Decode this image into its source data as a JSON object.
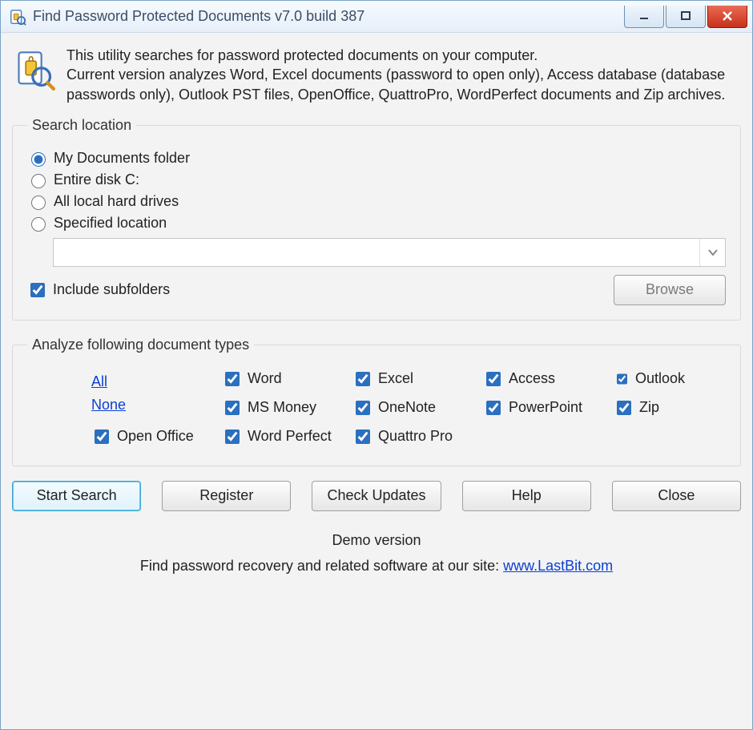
{
  "window": {
    "title": "Find Password Protected Documents v7.0 build 387"
  },
  "header": {
    "description": "This utility searches for password protected documents on your computer.\nCurrent version analyzes Word, Excel documents (password to open only), Access database (database passwords only), Outlook PST files, OpenOffice, QuattroPro, WordPerfect documents and Zip archives."
  },
  "search_location": {
    "legend": "Search location",
    "options": [
      {
        "label": "My Documents folder",
        "selected": true
      },
      {
        "label": "Entire disk C:",
        "selected": false
      },
      {
        "label": "All local hard drives",
        "selected": false
      },
      {
        "label": "Specified location",
        "selected": false
      }
    ],
    "path_value": "",
    "include_subfolders_label": "Include subfolders",
    "include_subfolders_checked": true,
    "browse_label": "Browse"
  },
  "doc_types": {
    "legend": "Analyze following document types",
    "items": [
      {
        "label": "Word",
        "checked": true
      },
      {
        "label": "Excel",
        "checked": true
      },
      {
        "label": "Access",
        "checked": true
      },
      {
        "label": "Outlook",
        "checked": true
      },
      {
        "label": "MS Money",
        "checked": true
      },
      {
        "label": "OneNote",
        "checked": true
      },
      {
        "label": "PowerPoint",
        "checked": true
      },
      {
        "label": "Zip",
        "checked": true
      },
      {
        "label": "Open Office",
        "checked": true
      },
      {
        "label": "Word Perfect",
        "checked": true
      },
      {
        "label": "Quattro Pro",
        "checked": true
      }
    ],
    "all_label": "All",
    "none_label": "None"
  },
  "buttons": {
    "start_search": "Start Search",
    "register": "Register",
    "check_updates": "Check Updates",
    "help": "Help",
    "close": "Close"
  },
  "footer": {
    "status": "Demo version",
    "promo_prefix": "Find password recovery and related software at our site: ",
    "promo_link": "www.LastBit.com"
  }
}
